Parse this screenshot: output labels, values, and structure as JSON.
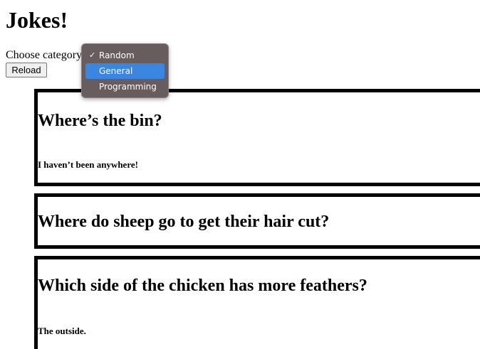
{
  "page": {
    "title": "Jokes!"
  },
  "controls": {
    "category_label": "Choose category",
    "reload_label": "Reload"
  },
  "dropdown": {
    "options": [
      {
        "label": "Random",
        "checked": true,
        "highlighted": false
      },
      {
        "label": "General",
        "checked": false,
        "highlighted": true
      },
      {
        "label": "Programming",
        "checked": false,
        "highlighted": false
      }
    ],
    "check_glyph": "✓",
    "menu_color": "#685d5d",
    "highlight_color": "#3a86e0"
  },
  "jokes": [
    {
      "setup": "Where’s the bin?",
      "punchline": "I haven’t been anywhere!"
    },
    {
      "setup": "Where do sheep go to get their hair cut?",
      "punchline": ""
    },
    {
      "setup": "Which side of the chicken has more feathers?",
      "punchline": "The outside."
    }
  ]
}
